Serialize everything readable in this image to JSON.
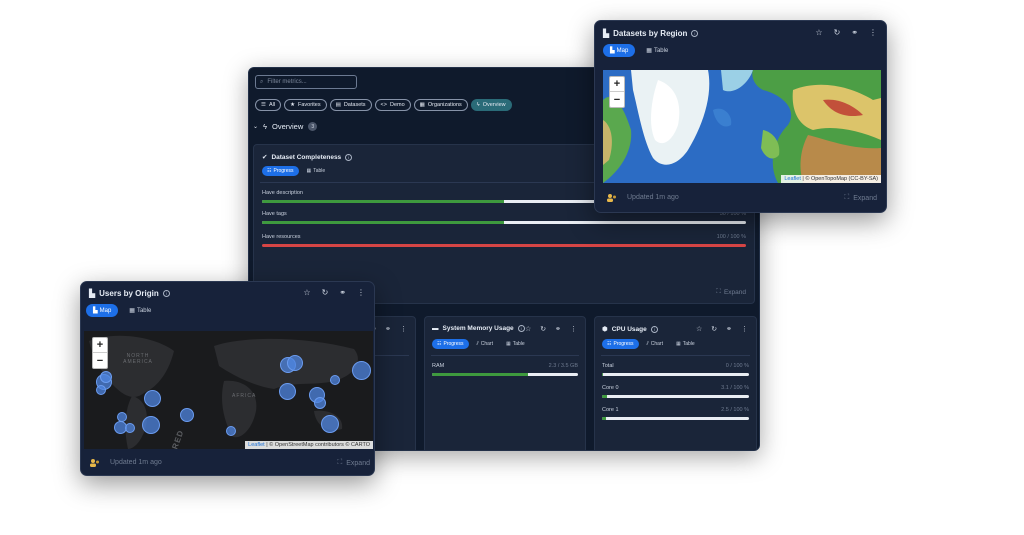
{
  "dashboard": {
    "filter_placeholder": "Filter metrics...",
    "chips": [
      {
        "label": "All",
        "icon": "list-icon",
        "active": false
      },
      {
        "label": "Favorites",
        "icon": "star-icon",
        "active": false
      },
      {
        "label": "Datasets",
        "icon": "document-icon",
        "active": false
      },
      {
        "label": "Demo",
        "icon": "code-icon",
        "active": false
      },
      {
        "label": "Organizations",
        "icon": "organization-icon",
        "active": false
      },
      {
        "label": "Overview",
        "icon": "bolt-icon",
        "active": true
      }
    ],
    "section_title": "Overview",
    "section_count": "3"
  },
  "completeness": {
    "title": "Dataset Completeness",
    "tabs": [
      "Progress",
      "Table"
    ],
    "rows": [
      {
        "label": "Have description",
        "value_text": "",
        "fraction": 0.5,
        "color": "#3e9a3e"
      },
      {
        "label": "Have tags",
        "value_text": "50 / 100 %",
        "fraction": 0.5,
        "color": "#3e9a3e"
      },
      {
        "label": "Have resources",
        "value_text": "100 / 100 %",
        "fraction": 1.0,
        "color": "#d64545"
      }
    ],
    "expand_label": "Expand"
  },
  "memory": {
    "title": "System Memory Usage",
    "tabs": [
      "Progress",
      "Chart",
      "Table"
    ],
    "rows": [
      {
        "label": "RAM",
        "value_text": "2.3 / 3.5 GB",
        "fraction": 0.66
      }
    ]
  },
  "cpu": {
    "title": "CPU Usage",
    "tabs": [
      "Progress",
      "Chart",
      "Table"
    ],
    "rows": [
      {
        "label": "Total",
        "value_text": "0 / 100 %",
        "fraction": 0.005
      },
      {
        "label": "Core 0",
        "value_text": "3.1 / 100 %",
        "fraction": 0.031
      },
      {
        "label": "Core 1",
        "value_text": "2.5 / 100 %",
        "fraction": 0.025
      }
    ]
  },
  "region_widget": {
    "title": "Datasets by Region",
    "tabs": [
      "Map",
      "Table"
    ],
    "attribution_link": "Leaflet",
    "attribution_text": "| © OpenTopoMap (CC-BY-SA)",
    "updated": "Updated 1m ago",
    "expand_label": "Expand",
    "zoom_in": "+",
    "zoom_out": "−"
  },
  "origin_widget": {
    "title": "Users by Origin",
    "tabs": [
      "Map",
      "Table"
    ],
    "map_labels": [
      "NORTH AMERICA",
      "AFRICA",
      "RED"
    ],
    "attribution_link": "Leaflet",
    "attribution_text": "| © OpenStreetMap contributors © CARTO",
    "updated": "Updated 1m ago",
    "expand_label": "Expand",
    "zoom_in": "+",
    "zoom_out": "−"
  },
  "colors": {
    "accent": "#1d6fe8",
    "overview_chip": "#2a6b78",
    "progress_green": "#3e9a3e",
    "progress_red": "#d64545",
    "bubble": "#4f86e0"
  }
}
